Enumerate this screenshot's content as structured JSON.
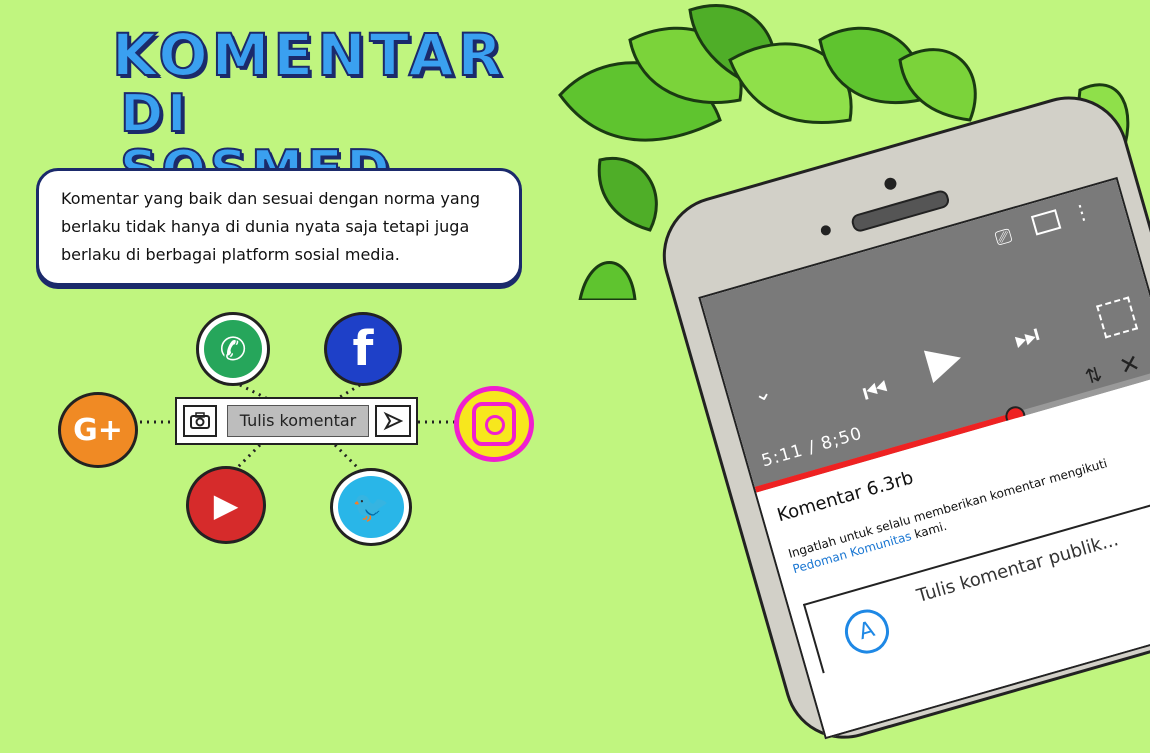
{
  "title": {
    "line1": "KOMENTAR",
    "line2": "DI SOSMED"
  },
  "description": "Komentar yang baik dan sesuai dengan norma yang berlaku tidak hanya di dunia nyata saja tetapi juga berlaku di berbagai platform sosial media.",
  "comment_bar": {
    "placeholder": "Tulis komentar",
    "camera_icon": "camera-icon",
    "send_icon": "send-icon"
  },
  "social_icons": {
    "whatsapp": {
      "icon": "whatsapp-icon",
      "color": "#26a65b"
    },
    "facebook": {
      "icon": "facebook-icon",
      "color": "#1e40c8"
    },
    "google_plus": {
      "icon": "google-plus-icon",
      "color": "#f08a24",
      "label": "G+"
    },
    "instagram": {
      "icon": "instagram-icon",
      "color": "#f01fcf"
    },
    "youtube": {
      "icon": "youtube-icon",
      "color": "#d62b2b"
    },
    "twitter": {
      "icon": "twitter-icon",
      "color": "#29b6e8"
    }
  },
  "phone": {
    "video": {
      "time": "5:11 / 8;50",
      "progress": 0.62
    },
    "comments": {
      "title": "Komentar 6.3rb",
      "note_prefix": "Ingatlah untuk selalu memberikan komentar mengikuti",
      "note_link": "Pedoman Komunitas",
      "note_suffix": "kami.",
      "input_placeholder": "Tulis komentar publik...",
      "avatar_letter": "A"
    }
  },
  "colors": {
    "background": "#c0f57f",
    "title_fill": "#3aa0f0",
    "title_outline": "#1b2a6b",
    "accent_red": "#e22222"
  }
}
